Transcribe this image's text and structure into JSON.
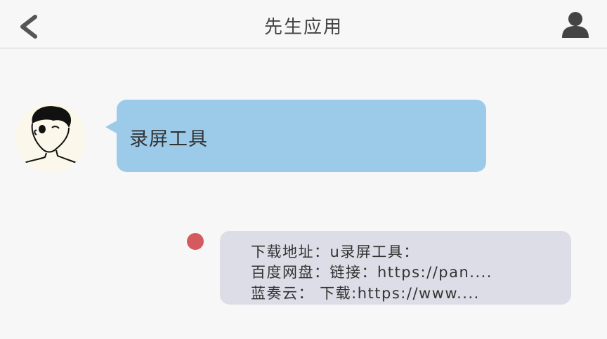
{
  "header": {
    "title": "先生应用",
    "back_icon": "chevron-left-icon",
    "profile_icon": "user-silhouette-icon"
  },
  "messages": [
    {
      "sender": "other",
      "avatar_icon": "sketch-face-avatar",
      "text": "录屏工具",
      "bubble_color": "#9ccbea"
    },
    {
      "sender": "self",
      "status_dot_color": "#d55a5f",
      "bubble_color": "#dcdde6",
      "lines": [
        "下载地址：u录屏工具：",
        "百度网盘：链接：https://pan....",
        "蓝奏云：  下载:https://www...."
      ]
    }
  ],
  "colors": {
    "background": "#f7f7f7",
    "text": "#333333"
  }
}
